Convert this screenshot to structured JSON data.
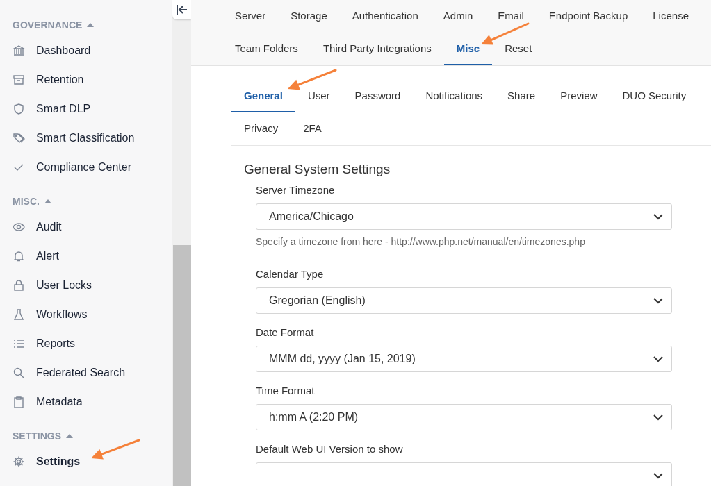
{
  "sidebar": {
    "sections": [
      {
        "title": "GOVERNANCE",
        "expanded": true,
        "items": [
          {
            "label": "Dashboard",
            "selected": false
          },
          {
            "label": "Retention",
            "selected": false
          },
          {
            "label": "Smart DLP",
            "selected": false
          },
          {
            "label": "Smart Classification",
            "selected": false
          },
          {
            "label": "Compliance Center",
            "selected": false
          }
        ]
      },
      {
        "title": "MISC.",
        "expanded": true,
        "items": [
          {
            "label": "Audit",
            "selected": false
          },
          {
            "label": "Alert",
            "selected": false
          },
          {
            "label": "User Locks",
            "selected": false
          },
          {
            "label": "Workflows",
            "selected": false
          },
          {
            "label": "Reports",
            "selected": false
          },
          {
            "label": "Federated Search",
            "selected": false
          },
          {
            "label": "Metadata",
            "selected": false
          }
        ]
      },
      {
        "title": "SETTINGS",
        "expanded": true,
        "items": [
          {
            "label": "Settings",
            "selected": true
          }
        ]
      }
    ]
  },
  "settings_tabs": [
    [
      {
        "label": "Server",
        "selected": false
      },
      {
        "label": "Storage",
        "selected": false
      },
      {
        "label": "Authentication",
        "selected": false
      },
      {
        "label": "Admin",
        "selected": false
      },
      {
        "label": "Email",
        "selected": false
      },
      {
        "label": "Endpoint Backup",
        "selected": false
      },
      {
        "label": "License",
        "selected": false
      }
    ],
    [
      {
        "label": "Team Folders",
        "selected": false
      },
      {
        "label": "Third Party Integrations",
        "selected": false
      },
      {
        "label": "Misc",
        "selected": true
      },
      {
        "label": "Reset",
        "selected": false
      }
    ]
  ],
  "misc_tabs": [
    [
      {
        "label": "General",
        "selected": true
      },
      {
        "label": "User",
        "selected": false
      },
      {
        "label": "Password",
        "selected": false
      },
      {
        "label": "Notifications",
        "selected": false
      },
      {
        "label": "Share",
        "selected": false
      },
      {
        "label": "Preview",
        "selected": false
      },
      {
        "label": "DUO Security",
        "selected": false
      }
    ],
    [
      {
        "label": "Privacy",
        "selected": false
      },
      {
        "label": "2FA",
        "selected": false
      }
    ]
  ],
  "panel": {
    "title": "General System Settings",
    "fields": [
      {
        "label": "Server Timezone",
        "value": "America/Chicago",
        "help": "Specify a timezone from here - http://www.php.net/manual/en/timezones.php"
      },
      {
        "label": "Calendar Type",
        "value": "Gregorian (English)"
      },
      {
        "label": "Date Format",
        "value": "MMM dd, yyyy (Jan 15, 2019)"
      },
      {
        "label": "Time Format",
        "value": "h:mm A (2:20 PM)"
      },
      {
        "label": "Default Web UI Version to show"
      }
    ]
  }
}
